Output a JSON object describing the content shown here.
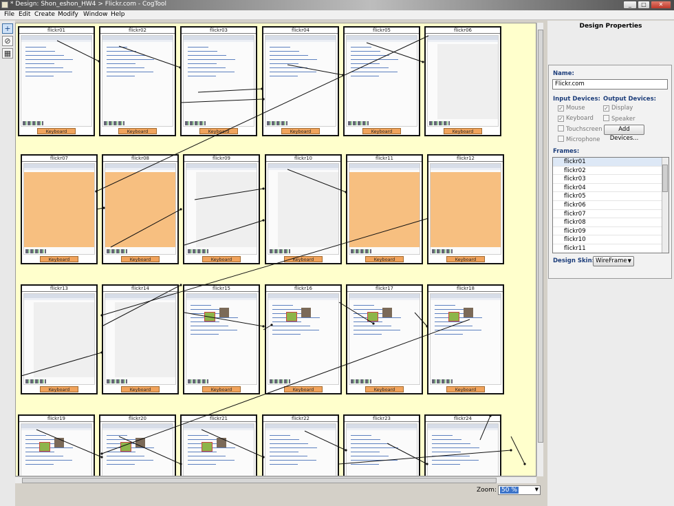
{
  "window": {
    "title": "* Design: Shon_eshon_HW4 > Flickr.com - CogTool"
  },
  "menu": [
    "File",
    "Edit",
    "Create",
    "Modify",
    "Window",
    "Help"
  ],
  "tools": [
    {
      "icon": "select-pointer-icon"
    },
    {
      "icon": "draw-widget-icon"
    },
    {
      "icon": "frame-grid-icon"
    }
  ],
  "canvas": {
    "frame_names": [
      "flickr01",
      "flickr02",
      "flickr03",
      "flickr04",
      "flickr05",
      "flickr06",
      "flickr07",
      "flickr08",
      "flickr09",
      "flickr10",
      "flickr11",
      "flickr12",
      "flickr13",
      "flickr14",
      "flickr15",
      "flickr16",
      "flickr17",
      "flickr18",
      "flickr19",
      "flickr20",
      "flickr21",
      "flickr22",
      "flickr23",
      "flickr24"
    ],
    "device_label": "Keyboard"
  },
  "zoom": {
    "label": "Zoom:",
    "value": "50 %"
  },
  "design_properties": {
    "title": "Design Properties",
    "name_label": "Name:",
    "name_value": "Flickr.com",
    "input_devices_label": "Input Devices:",
    "output_devices_label": "Output Devices:",
    "input_devices": [
      {
        "label": "Mouse",
        "checked": true
      },
      {
        "label": "Keyboard",
        "checked": true
      },
      {
        "label": "Touchscreen",
        "checked": false
      },
      {
        "label": "Microphone",
        "checked": false
      }
    ],
    "output_devices": [
      {
        "label": "Display",
        "checked": true
      },
      {
        "label": "Speaker",
        "checked": false
      }
    ],
    "add_devices_label": "Add Devices...",
    "frames_label": "Frames:",
    "frames_list": [
      "flickr01",
      "flickr02",
      "flickr03",
      "flickr04",
      "flickr05",
      "flickr06",
      "flickr07",
      "flickr08",
      "flickr09",
      "flickr10",
      "flickr11"
    ],
    "design_skin_label": "Design Skin:",
    "design_skin_value": "WireFrame"
  }
}
